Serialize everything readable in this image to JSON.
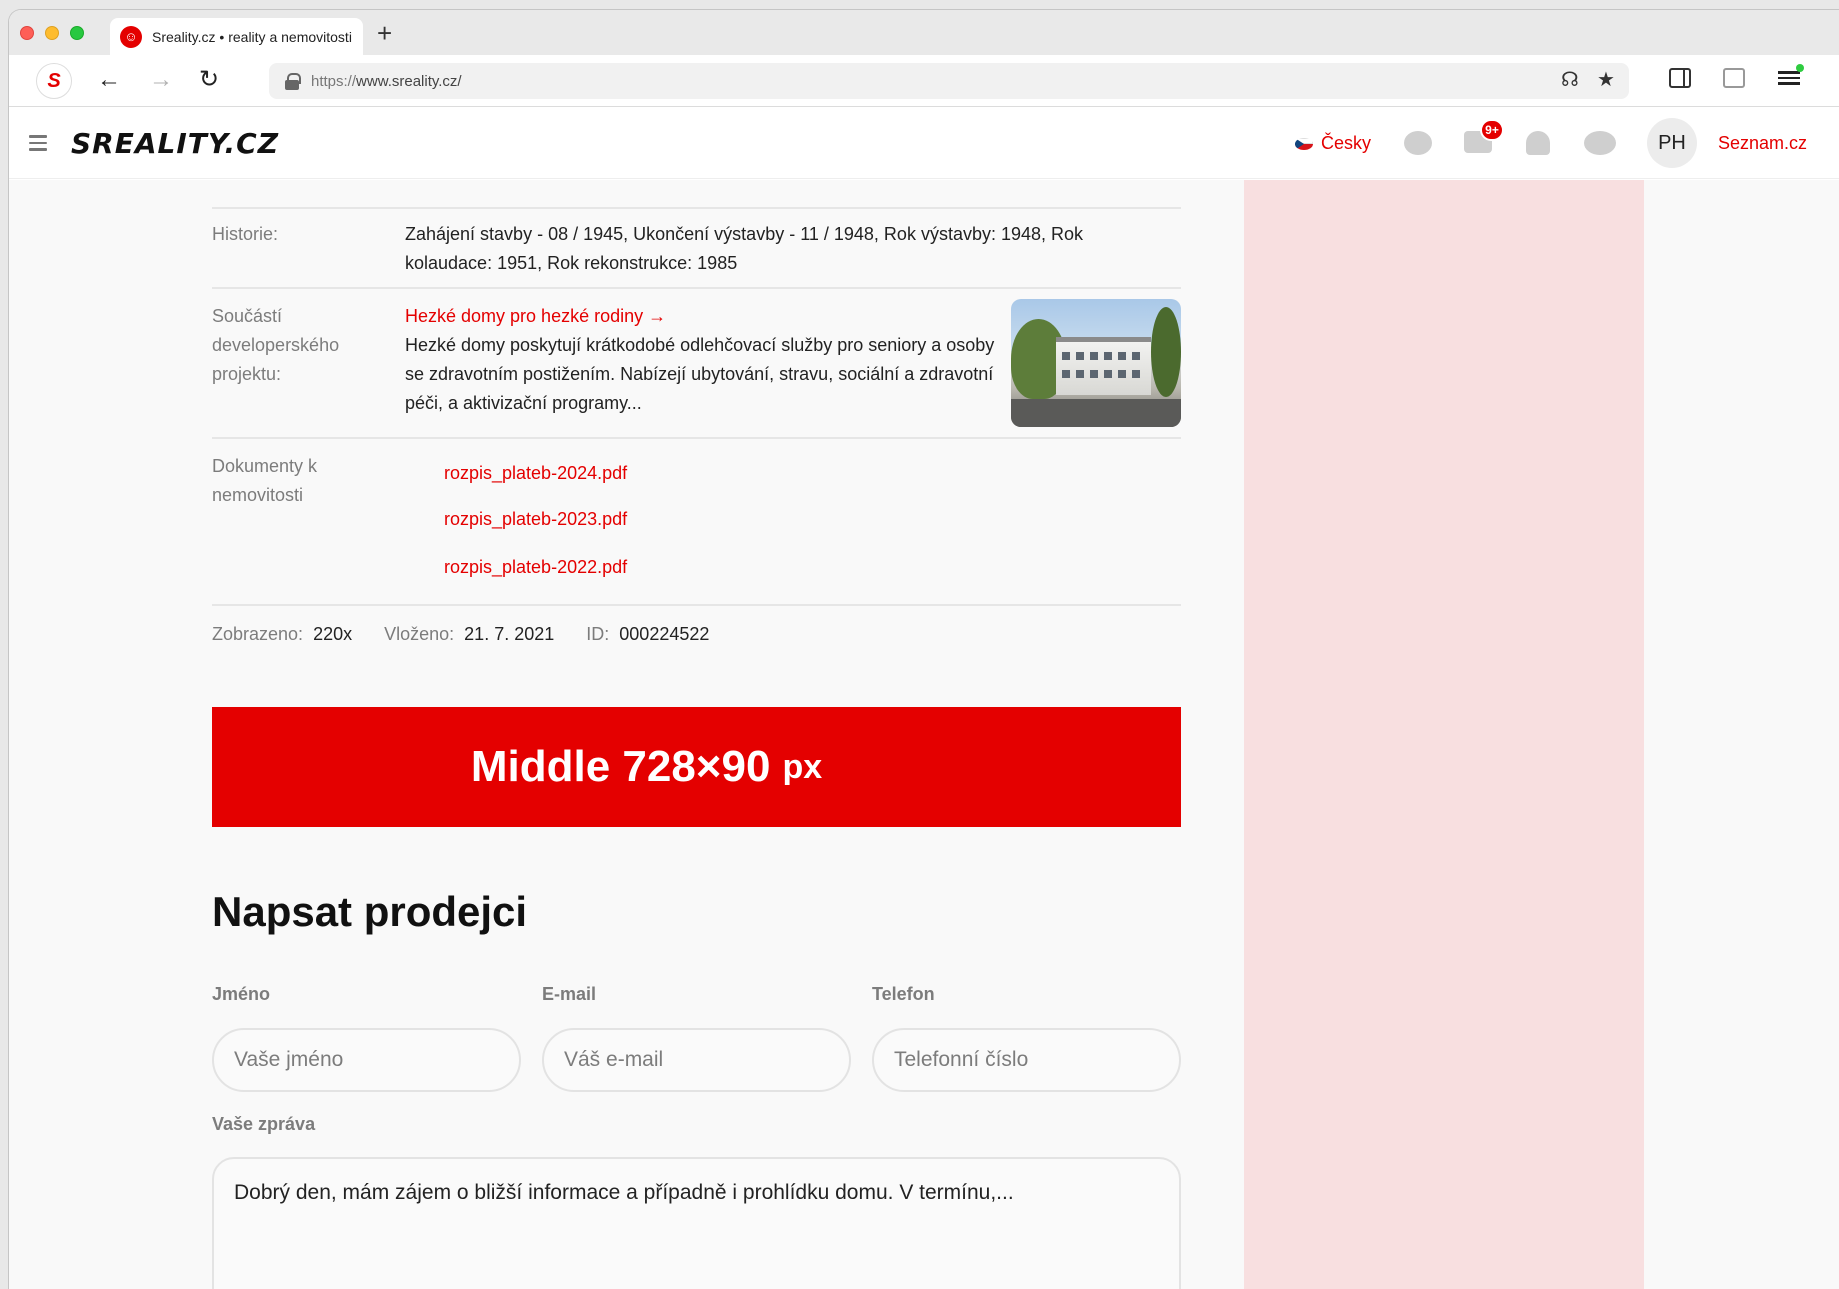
{
  "browser": {
    "tab_title": "Sreality.cz • reality a nemovitosti",
    "new_tab_label": "+",
    "url_protocol": "https://",
    "url_rest": "www.sreality.cz/"
  },
  "header": {
    "logo": "SREALITY.CZ",
    "language": "Česky",
    "mail_badge": "9+",
    "avatar_initials": "PH",
    "seznam_link": "Seznam.cz"
  },
  "details": {
    "history_label": "Historie:",
    "history_value": "Zahájení stavby - 08 / 1945, Ukončení výstavby - 11 / 1948, Rok výstavby: 1948, Rok kolaudace: 1951, Rok rekonstrukce: 1985",
    "project_label": "Součástí developerského projektu:",
    "project_link": "Hezké domy pro hezké rodiny →",
    "project_desc": "Hezké domy poskytují krátkodobé odlehčovací služby pro seniory a osoby se zdravotním postižením. Nabízejí ubytování, stravu, sociální a zdravotní péči, a aktivizační programy...",
    "docs_label": "Dokumenty k nemovitosti",
    "documents": [
      "rozpis_plateb-2024.pdf",
      "rozpis_plateb-2023.pdf",
      "rozpis_plateb-2022.pdf"
    ],
    "meta": {
      "views_label": "Zobrazeno:",
      "views_value": "220x",
      "inserted_label": "Vloženo:",
      "inserted_value": "21. 7. 2021",
      "id_label": "ID:",
      "id_value": "000224522"
    }
  },
  "banner": {
    "text": "Middle 728×90",
    "unit": "px"
  },
  "form": {
    "title": "Napsat prodejci",
    "name_label": "Jméno",
    "name_placeholder": "Vaše jméno",
    "email_label": "E-mail",
    "email_placeholder": "Váš e-mail",
    "phone_label": "Telefon",
    "phone_placeholder": "Telefonní číslo",
    "message_label": "Vaše zpráva",
    "message_value": "Dobrý den, mám zájem o bližší informace a případně i prohlídku domu. V termínu,..."
  },
  "colors": {
    "brand_red": "#e40000",
    "side_ad_bg": "#f8dfe0"
  }
}
